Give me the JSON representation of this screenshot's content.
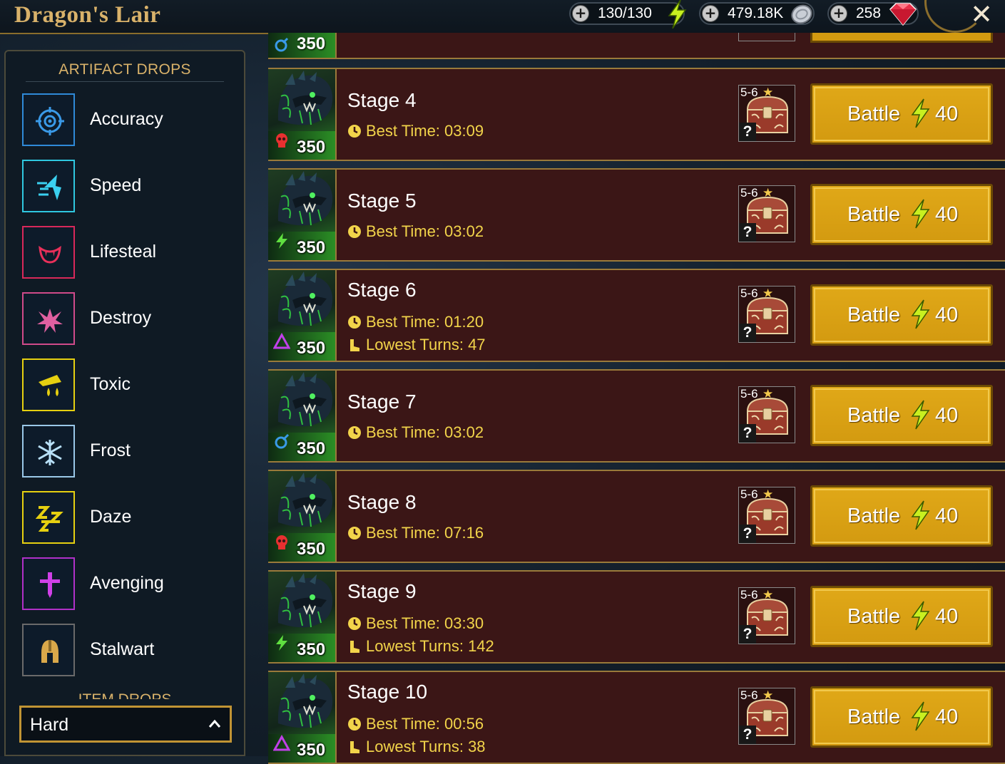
{
  "header": {
    "title": "Dragon's Lair",
    "energy": "130/130",
    "silver": "479.18K",
    "gems": "258",
    "close_label": "✕"
  },
  "sidebar": {
    "title": "ARTIFACT DROPS",
    "items": [
      {
        "label": "Accuracy",
        "color": "#2f8ad8"
      },
      {
        "label": "Speed",
        "color": "#2fc8e0"
      },
      {
        "label": "Lifesteal",
        "color": "#d8285a"
      },
      {
        "label": "Destroy",
        "color": "#d04a8a"
      },
      {
        "label": "Toxic",
        "color": "#e6d010"
      },
      {
        "label": "Frost",
        "color": "#9ac8e8"
      },
      {
        "label": "Daze",
        "color": "#e6d010"
      },
      {
        "label": "Avenging",
        "color": "#b030c8"
      },
      {
        "label": "Stalwart",
        "color": "#d9b26a"
      }
    ],
    "item_drops_title": "ITEM DROPS",
    "difficulty": "Hard"
  },
  "partial_stage": {
    "level": "350"
  },
  "stages": [
    {
      "name": "Stage 4",
      "level": "350",
      "affinity": "force",
      "best_time": "Best Time: 03:09",
      "lowest_turns": "",
      "drop": "5-6",
      "battle": "Battle",
      "cost": "40"
    },
    {
      "name": "Stage 5",
      "level": "350",
      "affinity": "spirit",
      "best_time": "Best Time: 03:02",
      "lowest_turns": "",
      "drop": "5-6",
      "battle": "Battle",
      "cost": "40"
    },
    {
      "name": "Stage 6",
      "level": "350",
      "affinity": "void",
      "best_time": "Best Time: 01:20",
      "lowest_turns": "Lowest Turns: 47",
      "drop": "5-6",
      "battle": "Battle",
      "cost": "40"
    },
    {
      "name": "Stage 7",
      "level": "350",
      "affinity": "magic",
      "best_time": "Best Time: 03:02",
      "lowest_turns": "",
      "drop": "5-6",
      "battle": "Battle",
      "cost": "40"
    },
    {
      "name": "Stage 8",
      "level": "350",
      "affinity": "force",
      "best_time": "Best Time: 07:16",
      "lowest_turns": "",
      "drop": "5-6",
      "battle": "Battle",
      "cost": "40"
    },
    {
      "name": "Stage 9",
      "level": "350",
      "affinity": "spirit",
      "best_time": "Best Time: 03:30",
      "lowest_turns": "Lowest Turns: 142",
      "drop": "5-6",
      "battle": "Battle",
      "cost": "40"
    },
    {
      "name": "Stage 10",
      "level": "350",
      "affinity": "void",
      "best_time": "Best Time: 00:56",
      "lowest_turns": "Lowest Turns: 38",
      "drop": "5-6",
      "battle": "Battle",
      "cost": "40"
    }
  ]
}
